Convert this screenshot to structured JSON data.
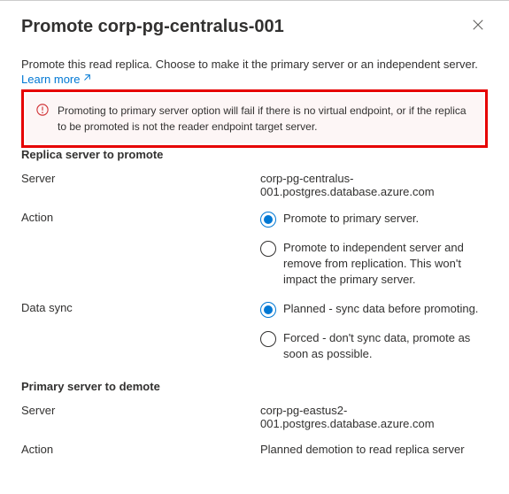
{
  "header": {
    "title": "Promote corp-pg-centralus-001"
  },
  "intro": {
    "text": "Promote this read replica. Choose to make it the primary server or an independent server.",
    "learn_more": "Learn more"
  },
  "alert": {
    "text": "Promoting to primary server option will fail if there is no virtual endpoint, or if the replica to be promoted is not the reader endpoint target server."
  },
  "replica_section": {
    "title": "Replica server to promote",
    "server_label": "Server",
    "server_value": "corp-pg-centralus-001.postgres.database.azure.com",
    "action_label": "Action",
    "action_options": [
      "Promote to primary server.",
      "Promote to independent server and remove from replication. This won't impact the primary server."
    ],
    "datasync_label": "Data sync",
    "datasync_options": [
      "Planned - sync data before promoting.",
      "Forced - don't sync data, promote as soon as possible."
    ]
  },
  "primary_section": {
    "title": "Primary server to demote",
    "server_label": "Server",
    "server_value": "corp-pg-eastus2-001.postgres.database.azure.com",
    "action_label": "Action",
    "action_value": "Planned demotion to read replica server"
  }
}
